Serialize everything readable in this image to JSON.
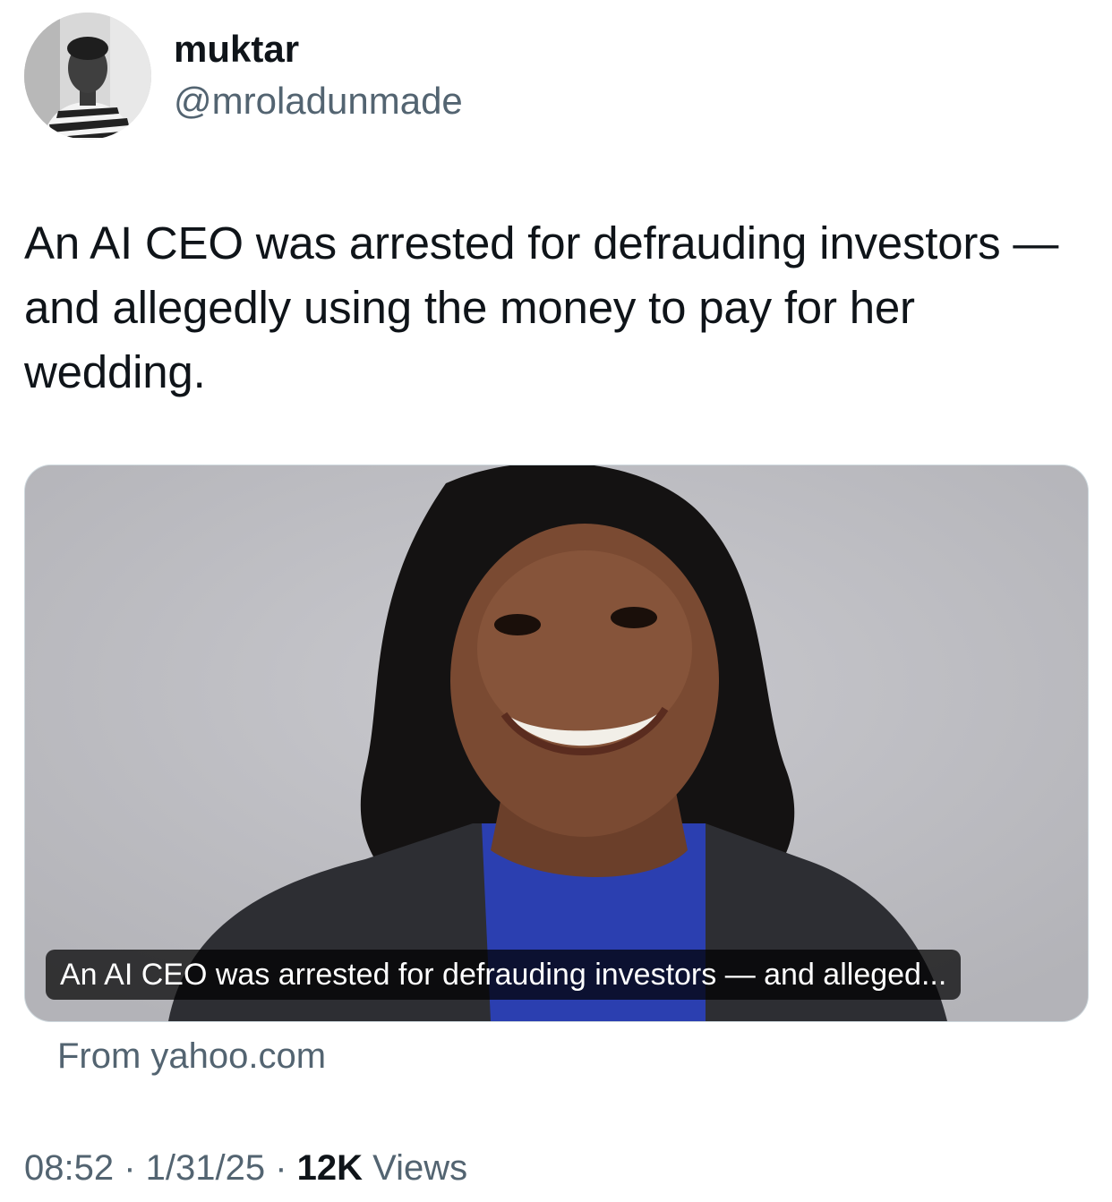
{
  "author": {
    "display_name": "muktar",
    "handle": "@mroladunmade",
    "avatar_icon": "profile-photo"
  },
  "tweet": {
    "text": "An AI CEO was arrested for defrauding investors — and allegedly using the money to pay for her wedding."
  },
  "link_card": {
    "caption": "An AI CEO was arrested for defrauding investors — and alleged...",
    "source": "From yahoo.com",
    "image_icon": "article-photo"
  },
  "meta": {
    "time": "08:52",
    "sep1": " · ",
    "date": "1/31/25",
    "sep2": " · ",
    "views_count": "12K",
    "views_label": " Views"
  },
  "colors": {
    "text_primary": "#0f1419",
    "text_secondary": "#536471",
    "card_border": "#cfd9de",
    "photo_background": "#bdbdc2"
  }
}
